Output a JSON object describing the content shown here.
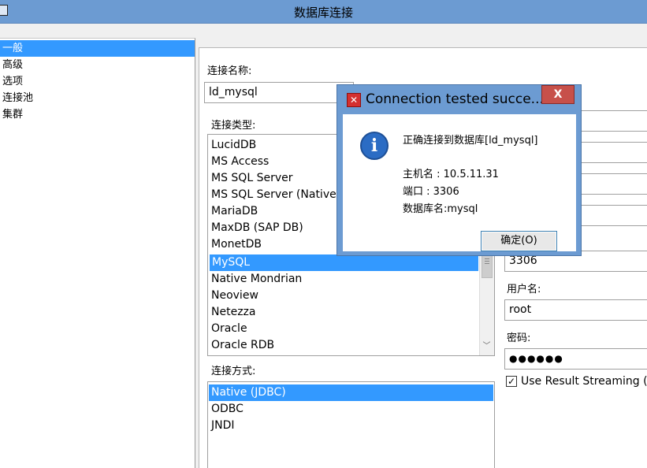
{
  "window": {
    "title": "数据库连接",
    "icon": "app-icon"
  },
  "nav": {
    "items": [
      {
        "label": "一般",
        "selected": true
      },
      {
        "label": "高级",
        "selected": false
      },
      {
        "label": "选项",
        "selected": false
      },
      {
        "label": "连接池",
        "selected": false
      },
      {
        "label": "集群",
        "selected": false
      }
    ]
  },
  "form": {
    "connection_name_label": "连接名称:",
    "connection_name_value": "ld_mysql",
    "connection_type_label": "连接类型:",
    "connection_types": [
      "LucidDB",
      "MS Access",
      "MS SQL Server",
      "MS SQL Server (Native)",
      "MariaDB",
      "MaxDB (SAP DB)",
      "MonetDB",
      "MySQL",
      "Native Mondrian",
      "Neoview",
      "Netezza",
      "Oracle",
      "Oracle RDB"
    ],
    "connection_type_selected": "MySQL",
    "access_label": "连接方式:",
    "access_methods": [
      "Native (JDBC)",
      "ODBC",
      "JNDI"
    ],
    "access_selected": "Native (JDBC)",
    "port_value": "3306",
    "username_label": "用户名:",
    "username_value": "root",
    "password_label": "密码:",
    "password_value": "●●●●●●",
    "streaming_label": "Use Result Streaming (",
    "streaming_checked": true
  },
  "dialog": {
    "title": "Connection tested succe...",
    "close_glyph": "X",
    "icon": "info-icon",
    "message": "正确连接到数据库[ld_mysql]",
    "host_line": "主机名      : 10.5.11.31",
    "port_line": "端口          : 3306",
    "db_line": "数据库名:mysql",
    "ok_label": "确定(O)"
  },
  "colors": {
    "title_bar": "#6c9bd2",
    "selection": "#3399ff",
    "close_button": "#c7504a"
  }
}
